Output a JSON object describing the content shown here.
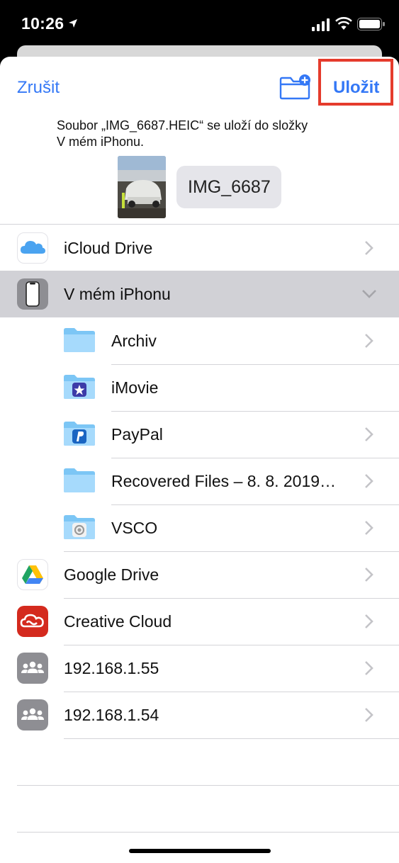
{
  "status_bar": {
    "time": "10:26"
  },
  "header": {
    "cancel_label": "Zrušit",
    "save_label": "Uložit",
    "message_line1": "Soubor „IMG_6687.HEIC“ se uloží do složky",
    "message_line2": "V mém iPhonu.",
    "file_name": "IMG_6687"
  },
  "locations": [
    {
      "label": "iCloud Drive",
      "icon": "icloud-icon"
    },
    {
      "label": "V mém iPhonu",
      "icon": "iphone-icon",
      "expanded": true,
      "selected": true
    },
    {
      "label": "Google Drive",
      "icon": "google-drive-icon"
    },
    {
      "label": "Creative Cloud",
      "icon": "creative-cloud-icon"
    },
    {
      "label": "192.168.1.55",
      "icon": "server-group-icon"
    },
    {
      "label": "192.168.1.54",
      "icon": "server-group-icon"
    }
  ],
  "folders": [
    {
      "label": "Archiv",
      "icon": "folder-icon"
    },
    {
      "label": "iMovie",
      "icon": "imovie-folder-icon"
    },
    {
      "label": "PayPal",
      "icon": "paypal-folder-icon"
    },
    {
      "label": "Recovered Files – 8. 8. 2019…",
      "icon": "folder-icon"
    },
    {
      "label": "VSCO",
      "icon": "vsco-folder-icon"
    }
  ],
  "colors": {
    "accent": "#3478f6",
    "highlight": "#e53b2c",
    "selected_row": "#d1d1d6"
  }
}
